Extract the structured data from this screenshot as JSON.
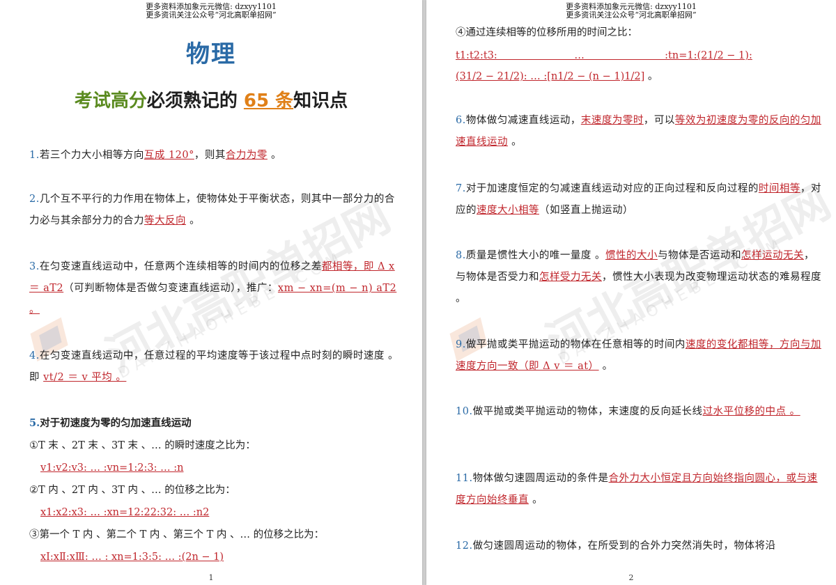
{
  "header": {
    "line1": "更多资料添加象元元微信: dzxyy1101",
    "line2": "更多资讯关注公众号“河北高职单招网”"
  },
  "watermark": {
    "main": "河北高职单招网",
    "sub": "DANZHAOHEBEI.COM"
  },
  "page1": {
    "title": "物理",
    "subtitle": {
      "a": "考试高分",
      "b": "必须熟记的 ",
      "c": "65 条",
      "d": "知识点"
    },
    "p1": {
      "num": "1.",
      "t1": "若三个力大小相等方向",
      "a1": "互成 120°",
      "t2": "，则其",
      "a2": "合力为零",
      "t3": " 。"
    },
    "p2": {
      "num": "2.",
      "t1": "几个互不平行的力作用在物体上，使物体处于平衡状态，则其中一部分力的合力必与其余部分力的合力",
      "a1": "等大反向",
      "t2": " 。"
    },
    "p3": {
      "num": "3.",
      "t1": "在匀变速直线运动中，任意两个连续相等的时间内的位移之差",
      "a1": "都相等，即 Δ x ＝ aT2",
      "t2": "（可判断物体是否做匀变速直线运动），推广：",
      "a2": "xm − xn=(m − n) aT2 。"
    },
    "p4": {
      "num": "4.",
      "t1": "在匀变速直线运动中，任意过程的平均速度等于该过程中点时刻的瞬时速度 。即 ",
      "a1": "vt/2 ＝ v 平均 。"
    },
    "p5": {
      "num": "5.",
      "title": "对于初速度为零的匀加速直线运动",
      "i1": "①T 末 、2T 末 、3T 末 、… 的瞬时速度之比为：",
      "a1": "v1:v2:v3: … :vn=1:2:3: … :n",
      "i2": "②T 内 、2T 内 、3T 内 、… 的位移之比为：",
      "a2": "x1:x2:x3: … :xn=12:22:32: … :n2",
      "i3": "③第一个 T 内 、第二个 T 内 、第三个 T 内 、… 的位移之比为：",
      "a3": "xⅠ:xⅡ:xⅢ: … : xn=1:3:5: … :(2n − 1)"
    },
    "page_number": "1"
  },
  "page2": {
    "i4": "④通过连续相等的位移所用的时间之比：",
    "a4_line1": "t1:t2:t3:                        …                         :tn=1:(21/2 − 1):",
    "a4_line2": "(31/2 − 21/2): … :[n1/2 − (n − 1)1/2]",
    "a4_end": " 。",
    "p6": {
      "num": "6.",
      "t1": "物体做匀减速直线运动，",
      "a1": "末速度为零时",
      "t2": "，可以",
      "a2": "等效为初速度为零的反向的匀加速直线运动",
      "t3": " 。"
    },
    "p7": {
      "num": "7.",
      "t1": "对于加速度恒定的匀减速直线运动对应的正向过程和反向过程的",
      "a1": "时间相等",
      "t2": "，对应的",
      "a2": "速度大小相等",
      "t3": "（如竖直上抛运动）"
    },
    "p8": {
      "num": "8.",
      "t1": "质量是惯性大小的唯一量度 。",
      "a1": "惯性的大小",
      "t2": "与物体是否运动和",
      "a2": "怎样运动无关",
      "t3": "，与物体是否受力和",
      "a3": "怎样受力无关",
      "t4": "，惯性大小表现为改变物理运动状态的难易程度 。"
    },
    "p9": {
      "num": "9.",
      "t1": "做平抛或类平抛运动的物体在任意相等的时间内",
      "a1": "速度的变化都相等，方向与加速度方向一致（即 Δ v ＝ at）",
      "t2": " 。"
    },
    "p10": {
      "num": "10.",
      "t1": "做平抛或类平抛运动的物体，末速度的反向延长线",
      "a1": "过水平位移的中点 。"
    },
    "p11": {
      "num": "11.",
      "t1": "物体做匀速圆周运动的条件是",
      "a1": "合外力大小恒定且方向始终指向圆心，或与速度方向始终垂直",
      "t2": " 。"
    },
    "p12": {
      "num": "12.",
      "t1": "做匀速圆周运动的物体，在所受到的合外力突然消失时，物体将沿"
    },
    "page_number": "2"
  }
}
